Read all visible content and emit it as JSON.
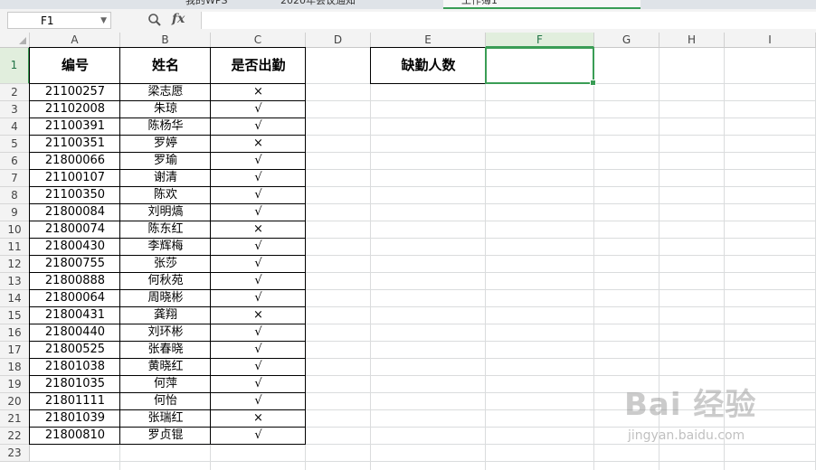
{
  "window": {
    "tabs": [
      "我的WPS",
      "2020年会议通知",
      "工作簿1"
    ]
  },
  "formula_bar": {
    "name_box": "F1",
    "fx_label": "fx",
    "value": ""
  },
  "columns": [
    "A",
    "B",
    "C",
    "D",
    "E",
    "F",
    "G",
    "H",
    "I"
  ],
  "rows": [
    "1",
    "2",
    "3",
    "4",
    "5",
    "6",
    "7",
    "8",
    "9",
    "10",
    "11",
    "12",
    "13",
    "14",
    "15",
    "16",
    "17",
    "18",
    "19",
    "20",
    "21",
    "22",
    "23"
  ],
  "selected_cell": "F1",
  "table": {
    "headers": [
      "编号",
      "姓名",
      "是否出勤"
    ],
    "rows": [
      [
        "21100257",
        "梁志愿",
        "×"
      ],
      [
        "21102008",
        "朱琼",
        "√"
      ],
      [
        "21100391",
        "陈杨华",
        "√"
      ],
      [
        "21100351",
        "罗婷",
        "×"
      ],
      [
        "21800066",
        "罗瑜",
        "√"
      ],
      [
        "21100107",
        "谢清",
        "√"
      ],
      [
        "21100350",
        "陈欢",
        "√"
      ],
      [
        "21800084",
        "刘明熇",
        "√"
      ],
      [
        "21800074",
        "陈东红",
        "×"
      ],
      [
        "21800430",
        "李辉梅",
        "√"
      ],
      [
        "21800755",
        "张莎",
        "√"
      ],
      [
        "21800888",
        "何秋苑",
        "√"
      ],
      [
        "21800064",
        "周晓彬",
        "√"
      ],
      [
        "21800431",
        "龚翔",
        "×"
      ],
      [
        "21800440",
        "刘环彬",
        "√"
      ],
      [
        "21800525",
        "张春晓",
        "√"
      ],
      [
        "21801038",
        "黄晓红",
        "√"
      ],
      [
        "21801035",
        "何萍",
        "√"
      ],
      [
        "21801111",
        "何怡",
        "√"
      ],
      [
        "21801039",
        "张瑞红",
        "×"
      ],
      [
        "21800810",
        "罗贞锟",
        "√"
      ]
    ]
  },
  "absence": {
    "label": "缺勤人数",
    "value": ""
  },
  "watermark": {
    "logo": "Bai 经验",
    "url": "jingyan.baidu.com"
  },
  "colors": {
    "accent": "#3a9d55",
    "header_bg": "#f3f3f3",
    "grid": "#dadcdd"
  }
}
